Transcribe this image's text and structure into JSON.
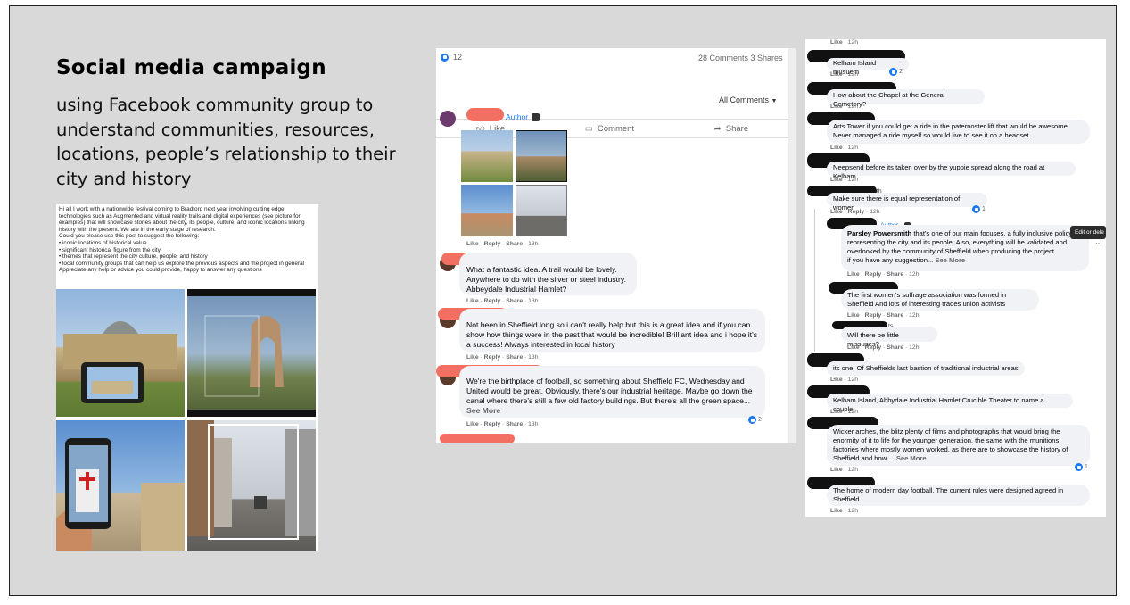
{
  "slide": {
    "title": "Social media campaign",
    "subtitle": "using Facebook community group to understand communities, resources, locations, people’s relationship to their city and history"
  },
  "post": {
    "lines": [
      "Hi all I work with a nationwide festival coming to Bradford next year involving cutting edge",
      "technologies such as Augmented and virtual reality trails and digital experiences (see picture for",
      "examples) that will showcase stories about the city, its people, culture, and iconic locations linking",
      "history with the present. We are in the early stage of research.",
      "Could you please use this post to suggest the following:",
      "• iconic locations of historical value",
      "• significant historical figure from the city",
      "• themes that represent the city culture, people, and history",
      "• local community groups that can help us explore the previous aspects and the project in general",
      "Appreciate any help or advice you could provide, happy to answer any questions"
    ]
  },
  "fb_panel_1": {
    "like_count": "12",
    "comments_shares": "28 Comments  3 Shares",
    "actions": {
      "like": "Like",
      "comment": "Comment",
      "share": "Share"
    },
    "sort": "All Comments",
    "author_tag": "Author",
    "author_meta": {
      "like": "Like",
      "reply": "Reply",
      "share": "Share",
      "time": "13h"
    },
    "comments": [
      {
        "text": "What a fantastic idea. A trail would be lovely. Anywhere to do with the silver or steel industry. Abbeydale Industrial Hamlet?",
        "like": "Like",
        "reply": "Reply",
        "share": "Share",
        "time": "13h"
      },
      {
        "text": "Not been in Sheffield long so i can't really help but this is a great idea and if you can show how things were in the past that would be incredible! Brilliant idea and i hope it's a success! Always interested in local history",
        "like": "Like",
        "reply": "Reply",
        "share": "Share",
        "time": "13h"
      },
      {
        "text": "We're the birthplace of football, so something about Sheffield FC, Wednesday and United would be great. Obviously, there's our industrial heritage. Maybe go down the canal where there's still a few old factory buildings. But there's all the green space...",
        "see_more": "See More",
        "like": "Like",
        "reply": "Reply",
        "share": "Share",
        "time": "13h",
        "reactions": "2"
      }
    ]
  },
  "fb_panel_2": {
    "top_meta": {
      "like": "Like",
      "time": "12h"
    },
    "comments": [
      {
        "text": "Kelham Island musuem",
        "like": "Like",
        "time": "12h",
        "reactions": "2"
      },
      {
        "text": "How about the Chapel at the General Cemetery?",
        "like": "Like",
        "time": "12h"
      },
      {
        "text": "Arts Tower if you could get a ride in the paternoster lift that would be awesome. Never managed a ride myself so would live to see it on a headset.",
        "like": "Like",
        "time": "12h"
      },
      {
        "text": "Neepsend before its taken over by the yuppie spread along the road at Kelham .",
        "like": "Like",
        "time": "12h"
      },
      {
        "text": "Make sure there is equal representation of women",
        "like": "Like",
        "reply": "Reply",
        "time": "12h",
        "reactions": "1",
        "name_tail": "th"
      }
    ],
    "replies": [
      {
        "author_tag": "Author",
        "name": "Parsley Powersmith",
        "text": "that's one of our main focuses, a fully inclusive policy representing the city and its people. Also, everything will be validated and overlooked by the community of Sheffield when producing the project.",
        "text2": "if you have any suggestion...",
        "see_more": "See More",
        "like": "Like",
        "reply": "Reply",
        "share": "Share",
        "time": "12h"
      },
      {
        "text": "The first women's suffrage association was formed in Sheffield And lots of interesting trades union activists",
        "like": "Like",
        "reply": "Reply",
        "share": "Share",
        "time": "12h"
      },
      {
        "text": "Will there be little missuses?",
        "like": "Like",
        "reply": "Reply",
        "share": "Share",
        "time": "12h",
        "name_tail": "ts"
      }
    ],
    "tooltip": "Edit or dele",
    "comments2": [
      {
        "text": "its one. Of Sheffields last bastion of traditional industrial areas .",
        "like": "Like",
        "time": "12h"
      },
      {
        "text": "Kelham Island, Abbydale Industrial Hamlet Crucible Theater to name a couple.",
        "like": "Like",
        "time": "12h"
      },
      {
        "text": "Wicker arches, the blitz plenty of films and photographs that would bring the enormity of it to life for the younger generation, the same with the munitions factories where mostly women worked, as there are to showcase the history of Sheffield and how ...",
        "see_more": "See More",
        "like": "Like",
        "time": "12h",
        "reactions": "1"
      },
      {
        "text": "The home of modern day football. The current rules were designed agreed in Sheffield",
        "like": "Like",
        "time": "12h"
      }
    ]
  },
  "colors": {
    "slide_bg": "#d9d9d9",
    "fb_blue": "#1877f2",
    "redaction_red": "#f36f62",
    "bubble": "#f0f2f5"
  }
}
